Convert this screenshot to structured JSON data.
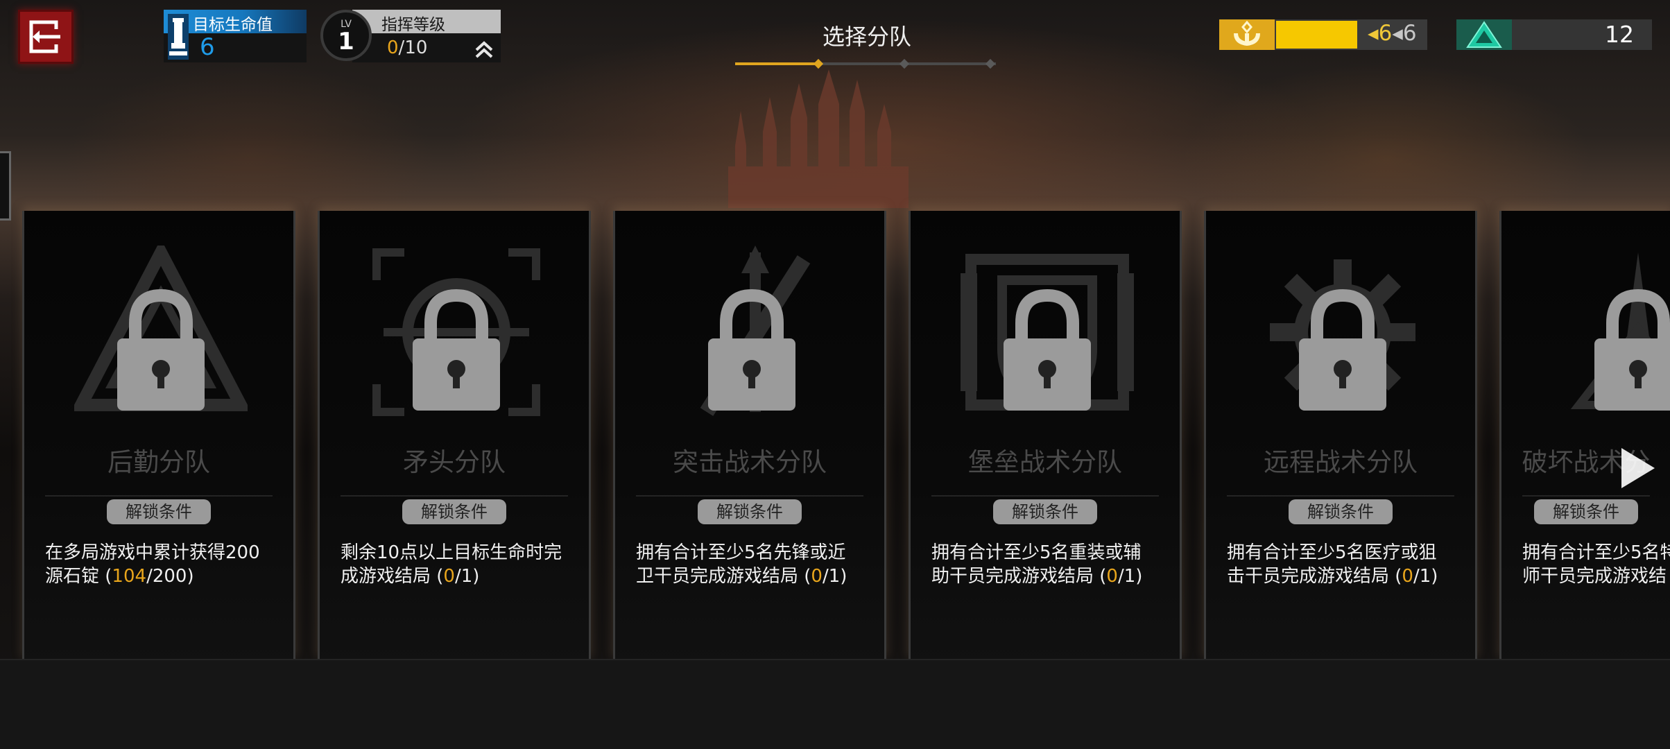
{
  "hud": {
    "life": {
      "label": "目标生命值",
      "value": "6"
    },
    "level": {
      "lv_label": "LV",
      "value": "1"
    },
    "command": {
      "label": "指挥等级",
      "exp_current": "0",
      "exp_sep": "/",
      "exp_max": "10"
    },
    "title": "选择分队",
    "steps": {
      "total": 3,
      "current": 1
    },
    "hope": {
      "prefix": "◂",
      "current": "6",
      "sep": "◂",
      "max": "6",
      "fill_fraction": 0.54,
      "color": "#f6c800"
    },
    "ingots": {
      "value": "12"
    }
  },
  "cards": [
    {
      "name": "后勤分队",
      "cond_label": "解锁条件",
      "cond_line1": "在多局游戏中累计获得200",
      "cond_line2a": "源石锭 (",
      "progress": "104",
      "cond_line2b": "/200)",
      "emblem": "triangle-emblem-icon"
    },
    {
      "name": "矛头分队",
      "cond_label": "解锁条件",
      "cond_line1": "剩余10点以上目标生命时完",
      "cond_line2a": "成游戏结局 (",
      "progress": "0",
      "cond_line2b": "/1)",
      "emblem": "crosshair-emblem-icon"
    },
    {
      "name": "突击战术分队",
      "cond_label": "解锁条件",
      "cond_line1": "拥有合计至少5名先锋或近",
      "cond_line2a": "卫干员完成游戏结局 (",
      "progress": "0",
      "cond_line2b": "/1)",
      "emblem": "sword-emblem-icon"
    },
    {
      "name": "堡垒战术分队",
      "cond_label": "解锁条件",
      "cond_line1": "拥有合计至少5名重装或辅",
      "cond_line2a": "助干员完成游戏结局 (",
      "progress": "0",
      "cond_line2b": "/1)",
      "emblem": "shield-emblem-icon"
    },
    {
      "name": "远程战术分队",
      "cond_label": "解锁条件",
      "cond_line1": "拥有合计至少5名医疗或狙",
      "cond_line2a": "击干员完成游戏结局 (",
      "progress": "0",
      "cond_line2b": "/1)",
      "emblem": "gear-emblem-icon"
    },
    {
      "name": "破坏战术分",
      "cond_label": "解锁条件",
      "cond_line1": "拥有合计至少5名特",
      "cond_line2a": "师干员完成游戏结",
      "progress": "",
      "cond_line2b": "",
      "emblem": "spire-emblem-icon"
    }
  ]
}
